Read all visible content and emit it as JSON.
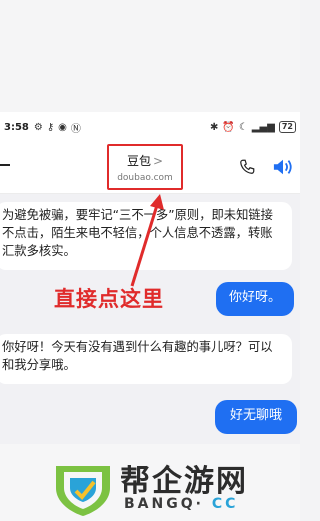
{
  "status_bar": {
    "time": "3:58",
    "battery": "72"
  },
  "header": {
    "title": "豆包",
    "chevron": ">",
    "subtitle": "doubao.com"
  },
  "messages": [
    {
      "role": "assistant",
      "text": "为避免被骗，要牢记“三不一多”原则，即未知链接不点击，陌生来电不轻信，个人信息不透露，转账汇款多核实。"
    },
    {
      "role": "user",
      "text": "你好呀。"
    },
    {
      "role": "assistant",
      "text": "你好呀！今天有没有遇到什么有趣的事儿呀？可以和我分享哦。"
    },
    {
      "role": "user",
      "text": "好无聊哦"
    }
  ],
  "annotation": {
    "text": "直接点这里",
    "color": "#e02b2b"
  },
  "watermark": {
    "brand_cn": "帮企游网",
    "brand_en_main": "BANGQ·",
    "brand_en_cc": "CC"
  },
  "colors": {
    "accent": "#1f6ff2",
    "annotation": "#e02b2b"
  },
  "icons": [
    "menu-icon",
    "phone-icon",
    "speaker-icon",
    "key-icon",
    "eye-icon",
    "nfc-icon",
    "bluetooth-icon",
    "alarm-icon",
    "moon-icon",
    "signal-icon",
    "battery-icon"
  ]
}
